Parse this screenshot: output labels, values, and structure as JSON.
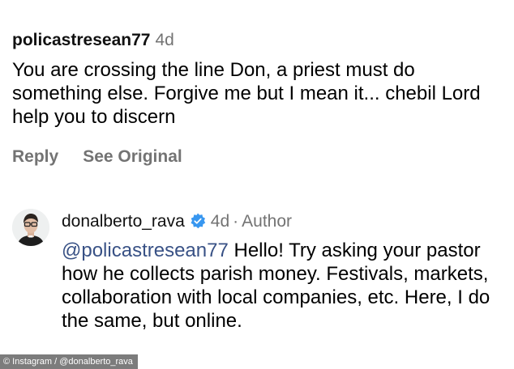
{
  "comment": {
    "username": "policastresean77",
    "time": "4d",
    "text": "You are crossing the line Don, a priest must do something else. Forgive me but I mean it... chebil Lord help you to discern",
    "actions": {
      "reply": "Reply",
      "see_original": "See Original"
    }
  },
  "reply": {
    "username": "donalberto_rava",
    "verified": true,
    "time": "4d",
    "separator": "·",
    "role": "Author",
    "mention": "@policastresean77",
    "text": " Hello! Try asking your pastor how he collects parish money. Festivals, markets, collaboration with local companies, etc. Here, I do the same, but online."
  },
  "watermark": "© Instagram / @donalberto_rava",
  "colors": {
    "secondary_text": "#737373",
    "mention": "#385185",
    "verified_badge": "#3897f0"
  },
  "icons": {
    "verified": "verified-badge-icon",
    "avatar": "avatar-icon"
  }
}
